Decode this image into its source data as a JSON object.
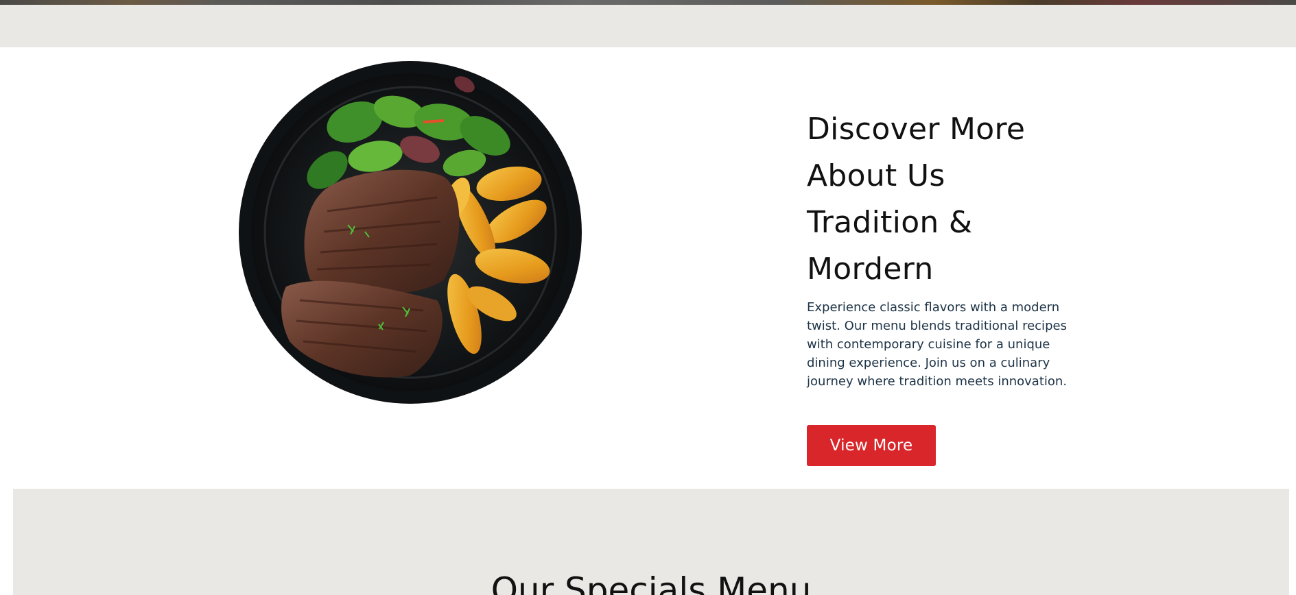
{
  "about": {
    "title_lines": [
      "Discover More",
      "About Us",
      "Tradition &",
      "Mordern"
    ],
    "description": "Experience classic flavors with a modern twist. Our menu blends traditional recipes with contemporary cuisine for a unique dining experience. Join us on a culinary journey where tradition meets innovation.",
    "button_label": "View More",
    "image": "steak-plate-photo"
  },
  "specials": {
    "title": "Our Specials Menu"
  },
  "colors": {
    "accent": "#d8262b",
    "band": "#eae8e5",
    "heading": "#111111",
    "body_text": "#1d3346"
  }
}
